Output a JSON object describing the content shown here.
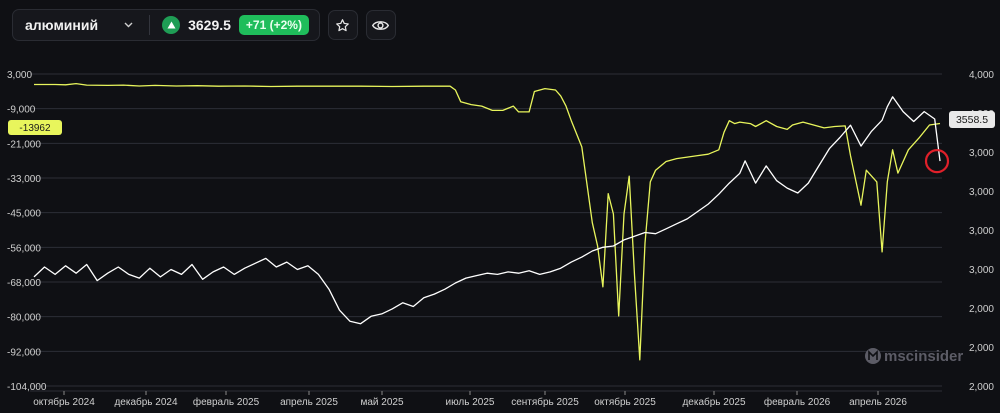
{
  "header": {
    "asset": "алюминий",
    "price": "3629.5",
    "change": "+71 (+2%)"
  },
  "colors": {
    "background": "#0f1014",
    "price_line": "#ffffff",
    "position_line": "#e8f55c",
    "change_badge": "#1fbd5b",
    "marker": "#e0202a"
  },
  "icons": [
    "chevron-down-icon",
    "triangle-up-icon",
    "star-icon",
    "eye-icon"
  ],
  "chart_data": {
    "type": "line",
    "x_ticks": [
      "октябрь 2024",
      "декабрь 2024",
      "февраль 2025",
      "апрель 2025",
      "май 2025",
      "июль 2025",
      "сентябрь 2025",
      "октябрь 2025",
      "декабрь 2025",
      "февраль 2026",
      "апрель 2026"
    ],
    "left_axis": {
      "ticks": [
        "3,000",
        "-9,000",
        "-21,000",
        "-33,000",
        "-45,000",
        "-56,000",
        "-68,000",
        "-80,000",
        "-92,000",
        "-104,000"
      ],
      "range": [
        -104000,
        3000
      ]
    },
    "right_axis": {
      "ticks": [
        "4,000",
        "4,000",
        "3,000",
        "3,000",
        "3,000",
        "3,000",
        "2,000",
        "2,000",
        "2,000"
      ],
      "range": [
        1800,
        4200
      ]
    },
    "left_badge": "-13962",
    "right_badge": "3558.5",
    "watermark": "mscinsider",
    "series": [
      {
        "axis": "left",
        "points": [
          [
            0,
            -600
          ],
          [
            4,
            -600
          ],
          [
            6,
            -700
          ],
          [
            8,
            -300
          ],
          [
            10,
            -800
          ],
          [
            14,
            -900
          ],
          [
            17,
            -800
          ],
          [
            20,
            -1100
          ],
          [
            23,
            -900
          ],
          [
            27,
            -1100
          ],
          [
            31,
            -1000
          ],
          [
            35,
            -1200
          ],
          [
            40,
            -1100
          ],
          [
            45,
            -1300
          ],
          [
            50,
            -1200
          ],
          [
            56,
            -1200
          ],
          [
            62,
            -1200
          ],
          [
            68,
            -1300
          ],
          [
            74,
            -1200
          ],
          [
            79,
            -1200
          ],
          [
            80,
            -2500
          ],
          [
            81,
            -6500
          ],
          [
            83,
            -7500
          ],
          [
            85,
            -8000
          ],
          [
            87,
            -9500
          ],
          [
            89,
            -9500
          ],
          [
            91,
            -8000
          ],
          [
            92,
            -10000
          ],
          [
            94,
            -10000
          ],
          [
            95,
            -3000
          ],
          [
            97,
            -2000
          ],
          [
            99,
            -2500
          ],
          [
            100,
            -4500
          ],
          [
            101,
            -8000
          ],
          [
            102,
            -13000
          ],
          [
            104,
            -22000
          ],
          [
            106,
            -48000
          ],
          [
            107,
            -56000
          ],
          [
            108,
            -70000
          ],
          [
            109,
            -38000
          ],
          [
            110,
            -45000
          ],
          [
            111,
            -80000
          ],
          [
            112,
            -45000
          ],
          [
            113,
            -32000
          ],
          [
            114,
            -66000
          ],
          [
            115,
            -95000
          ],
          [
            116,
            -55000
          ],
          [
            117,
            -34000
          ],
          [
            118,
            -30000
          ],
          [
            120,
            -27000
          ],
          [
            122,
            -26000
          ],
          [
            124,
            -25500
          ],
          [
            126,
            -25000
          ],
          [
            128,
            -24500
          ],
          [
            130,
            -23000
          ],
          [
            131,
            -17000
          ],
          [
            132,
            -13000
          ],
          [
            133,
            -14000
          ],
          [
            134,
            -13500
          ],
          [
            136,
            -14000
          ],
          [
            137,
            -15000
          ],
          [
            139,
            -13000
          ],
          [
            141,
            -15000
          ],
          [
            143,
            -16000
          ],
          [
            144,
            -14500
          ],
          [
            146,
            -13500
          ],
          [
            148,
            -14500
          ],
          [
            150,
            -15500
          ],
          [
            152,
            -15000
          ],
          [
            154,
            -14800
          ],
          [
            155,
            -25000
          ],
          [
            157,
            -42000
          ],
          [
            158,
            -30000
          ],
          [
            160,
            -34000
          ],
          [
            161,
            -58000
          ],
          [
            162,
            -34000
          ],
          [
            163,
            -23000
          ],
          [
            164,
            -31000
          ],
          [
            166,
            -23000
          ],
          [
            168,
            -19000
          ],
          [
            170,
            -14500
          ],
          [
            172,
            -13962
          ]
        ]
      },
      {
        "axis": "right",
        "points": [
          [
            0,
            2620
          ],
          [
            2,
            2700
          ],
          [
            4,
            2640
          ],
          [
            6,
            2710
          ],
          [
            8,
            2650
          ],
          [
            10,
            2720
          ],
          [
            12,
            2590
          ],
          [
            14,
            2650
          ],
          [
            16,
            2700
          ],
          [
            18,
            2640
          ],
          [
            20,
            2610
          ],
          [
            22,
            2690
          ],
          [
            24,
            2620
          ],
          [
            26,
            2680
          ],
          [
            28,
            2640
          ],
          [
            30,
            2720
          ],
          [
            32,
            2600
          ],
          [
            34,
            2660
          ],
          [
            36,
            2700
          ],
          [
            38,
            2640
          ],
          [
            40,
            2690
          ],
          [
            42,
            2730
          ],
          [
            44,
            2770
          ],
          [
            46,
            2700
          ],
          [
            48,
            2740
          ],
          [
            50,
            2680
          ],
          [
            52,
            2710
          ],
          [
            54,
            2640
          ],
          [
            56,
            2520
          ],
          [
            58,
            2350
          ],
          [
            60,
            2260
          ],
          [
            62,
            2240
          ],
          [
            64,
            2300
          ],
          [
            66,
            2320
          ],
          [
            68,
            2360
          ],
          [
            70,
            2410
          ],
          [
            72,
            2380
          ],
          [
            74,
            2450
          ],
          [
            76,
            2480
          ],
          [
            78,
            2520
          ],
          [
            80,
            2570
          ],
          [
            82,
            2610
          ],
          [
            84,
            2630
          ],
          [
            86,
            2650
          ],
          [
            88,
            2640
          ],
          [
            90,
            2660
          ],
          [
            92,
            2650
          ],
          [
            94,
            2670
          ],
          [
            96,
            2640
          ],
          [
            98,
            2660
          ],
          [
            100,
            2690
          ],
          [
            102,
            2740
          ],
          [
            104,
            2780
          ],
          [
            106,
            2830
          ],
          [
            108,
            2860
          ],
          [
            110,
            2870
          ],
          [
            112,
            2920
          ],
          [
            114,
            2950
          ],
          [
            116,
            2980
          ],
          [
            118,
            2970
          ],
          [
            120,
            3010
          ],
          [
            122,
            3050
          ],
          [
            124,
            3090
          ],
          [
            126,
            3150
          ],
          [
            128,
            3210
          ],
          [
            130,
            3290
          ],
          [
            132,
            3380
          ],
          [
            134,
            3460
          ],
          [
            135,
            3560
          ],
          [
            137,
            3380
          ],
          [
            139,
            3520
          ],
          [
            141,
            3400
          ],
          [
            143,
            3340
          ],
          [
            145,
            3300
          ],
          [
            147,
            3380
          ],
          [
            149,
            3520
          ],
          [
            151,
            3660
          ],
          [
            153,
            3750
          ],
          [
            155,
            3850
          ],
          [
            157,
            3680
          ],
          [
            159,
            3800
          ],
          [
            161,
            3890
          ],
          [
            162,
            4000
          ],
          [
            163,
            4080
          ],
          [
            165,
            3960
          ],
          [
            167,
            3880
          ],
          [
            169,
            3960
          ],
          [
            171,
            3900
          ],
          [
            172,
            3558.5
          ]
        ]
      }
    ]
  }
}
